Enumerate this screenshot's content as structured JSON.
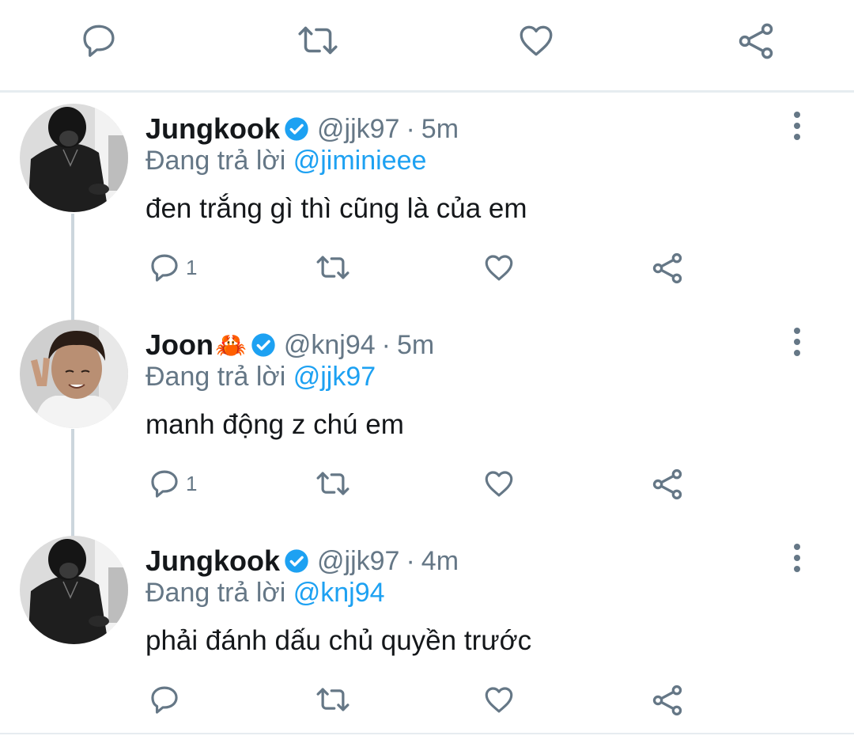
{
  "colors": {
    "accent": "#1da1f2",
    "verified": "#1da1f2",
    "secondary_text": "#657786",
    "icon": "#657786"
  },
  "top_actions": {
    "icons": [
      "reply-icon",
      "retweet-icon",
      "like-icon",
      "share-icon"
    ]
  },
  "tweets": [
    {
      "name": "Jungkook",
      "name_emoji": "",
      "verified": true,
      "handle": "@jjk97",
      "separator": "·",
      "time": "5m",
      "reply_prefix": "Đang trả lời",
      "reply_to": "@jiminieee",
      "text": "đen trắng gì thì cũng là của em",
      "reply_count": "1"
    },
    {
      "name": "Joon",
      "name_emoji": "🦀",
      "verified": true,
      "handle": "@knj94",
      "separator": "·",
      "time": "5m",
      "reply_prefix": "Đang trả lời",
      "reply_to": "@jjk97",
      "text": "manh động z chú em",
      "reply_count": "1"
    },
    {
      "name": "Jungkook",
      "name_emoji": "",
      "verified": true,
      "handle": "@jjk97",
      "separator": "·",
      "time": "4m",
      "reply_prefix": "Đang trả lời",
      "reply_to": "@knj94",
      "text": "phải đánh dấu chủ quyền trước",
      "reply_count": ""
    }
  ]
}
